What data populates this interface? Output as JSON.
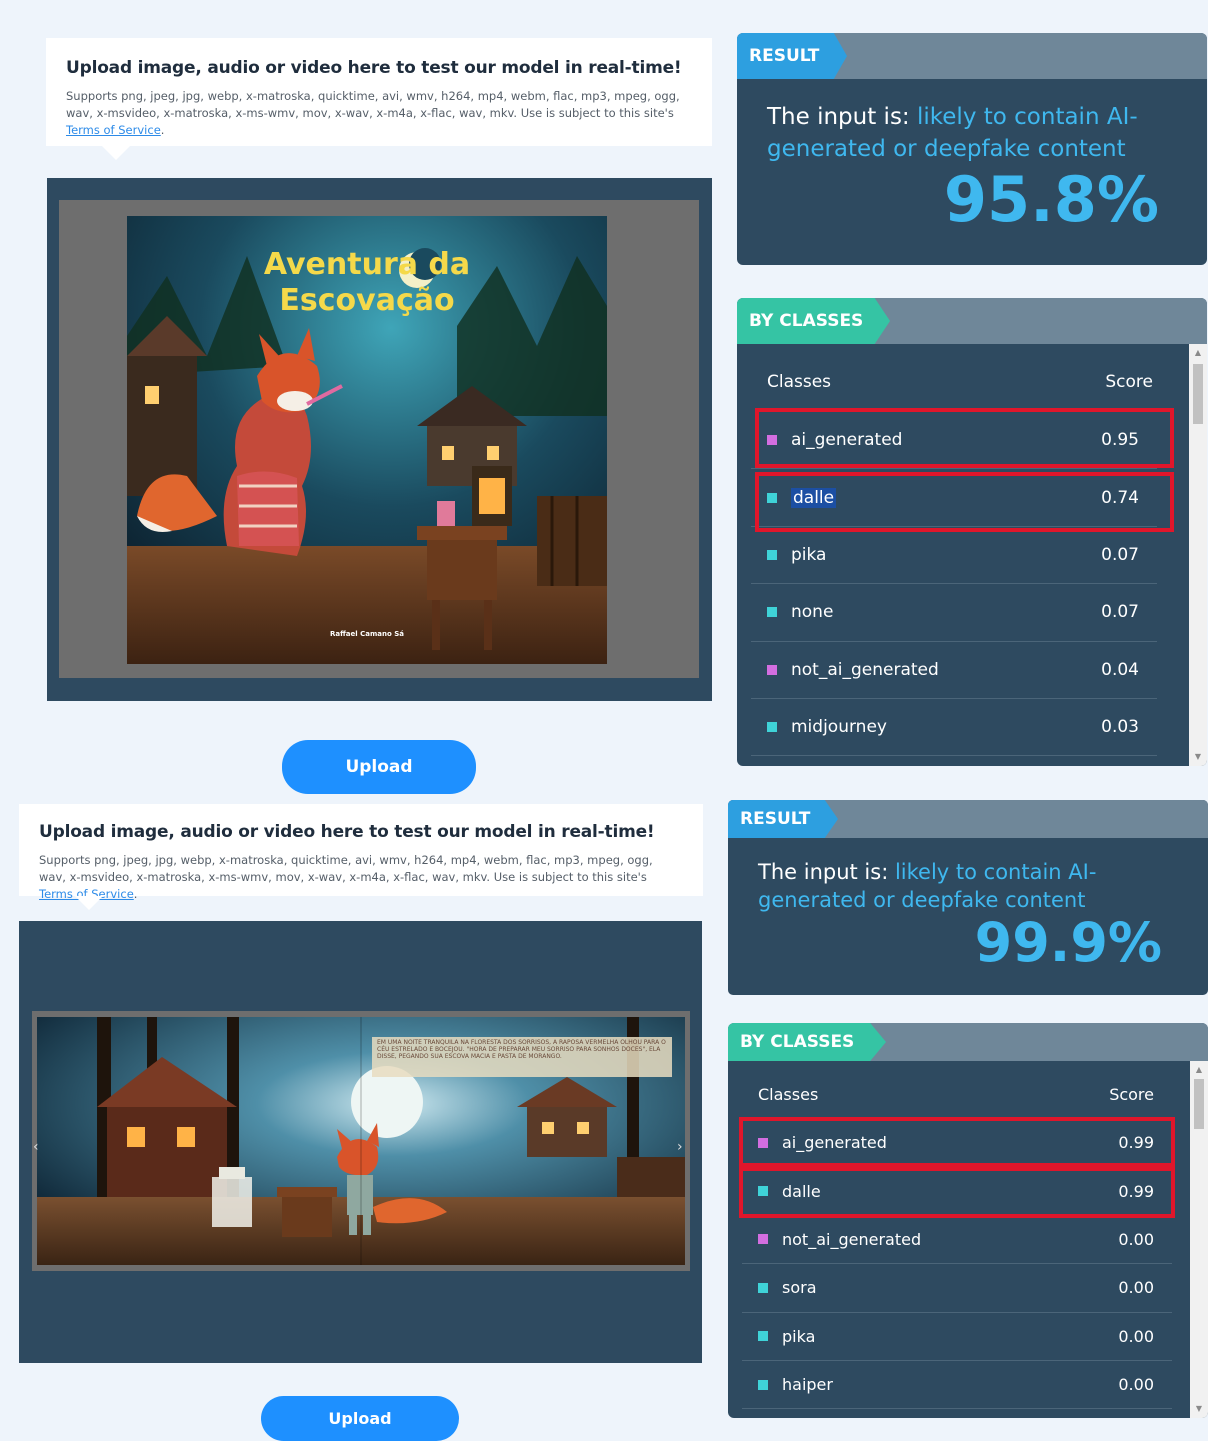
{
  "upload_title": "Upload image, audio or video here to test our model in real-time!",
  "upload_desc_prefix": "Supports png, jpeg, jpg, webp, x-matroska, quicktime, avi, wmv, h264, mp4, webm, flac, mp3, mpeg, ogg, wav, x-msvideo, x-matroska, x-ms-wmv, mov, x-wav, x-m4a, x-flac, wav, mkv. Use is subject to this site's ",
  "upload_desc_link": "Terms of Service",
  "upload_desc_suffix": ".",
  "upload_button": "Upload",
  "result_tag": "RESULT",
  "classes_tag": "BY CLASSES",
  "result_prefix": "The input is: ",
  "result_verdict": "likely to contain AI-generated or deepfake content",
  "classes_header": {
    "col1": "Classes",
    "col2": "Score"
  },
  "book1": {
    "title_line1": "Aventura da",
    "title_line2": "Escovação",
    "author": "Raffael Camano Sá"
  },
  "book2": {
    "caption": "EM UMA NOITE TRANQUILA NA FLORESTA DOS SORRISOS, A RAPOSA VERMELHA OLHOU PARA O CÉU ESTRELADO E BOCEJOU. \"HORA DE PREPARAR MEU SORRISO PARA SONHOS DOCES\", ELA DISSE, PEGANDO SUA ESCOVA MACIA E PASTA DE MORANGO."
  },
  "top": {
    "percent": "95.8%",
    "classes": [
      {
        "name": "ai_generated",
        "score": "0.95",
        "color": "#d36ee0"
      },
      {
        "name": "dalle",
        "score": "0.74",
        "color": "#3fd3d8"
      },
      {
        "name": "pika",
        "score": "0.07",
        "color": "#3fd3d8"
      },
      {
        "name": "none",
        "score": "0.07",
        "color": "#3fd3d8"
      },
      {
        "name": "not_ai_generated",
        "score": "0.04",
        "color": "#d36ee0"
      },
      {
        "name": "midjourney",
        "score": "0.03",
        "color": "#3fd3d8"
      }
    ]
  },
  "bottom": {
    "percent": "99.9%",
    "classes": [
      {
        "name": "ai_generated",
        "score": "0.99",
        "color": "#d36ee0"
      },
      {
        "name": "dalle",
        "score": "0.99",
        "color": "#3fd3d8"
      },
      {
        "name": "not_ai_generated",
        "score": "0.00",
        "color": "#d36ee0"
      },
      {
        "name": "sora",
        "score": "0.00",
        "color": "#3fd3d8"
      },
      {
        "name": "pika",
        "score": "0.00",
        "color": "#3fd3d8"
      },
      {
        "name": "haiper",
        "score": "0.00",
        "color": "#3fd3d8"
      }
    ]
  }
}
